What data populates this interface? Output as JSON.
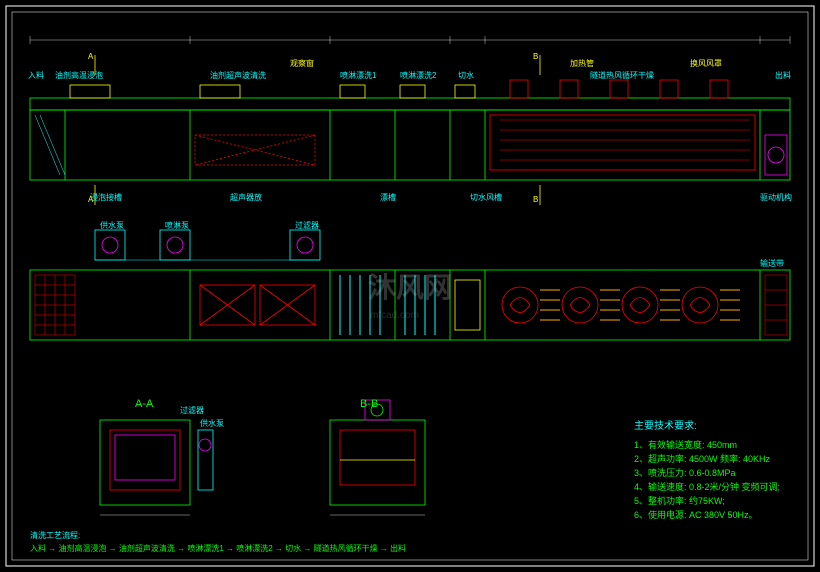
{
  "sections": {
    "A": "A",
    "AA": "A-A",
    "B": "B",
    "BB": "B-B"
  },
  "labels": {
    "inlet": "入料",
    "oil_hot_soak": "油剂高温浸泡",
    "oil_ultrasonic": "油剂超声波清洗",
    "spray_rinse1": "喷淋漂洗1",
    "spray_rinse2": "喷淋漂洗2",
    "air_cut": "切水",
    "tunnel_dry": "隧道热风循环干燥",
    "outlet": "出料",
    "view_window": "观察窗",
    "heating_tube": "加热管",
    "fan_hood": "换风风罩",
    "soak_slot": "浸泡接槽",
    "ultrasonic_box": "超声器放",
    "rinse_tank": "漂槽",
    "air_knife": "切水风槽",
    "drive": "驱动机构",
    "water_pump": "供水泵",
    "shower_pump": "喷淋泵",
    "filter": "过滤器",
    "conveyor": "输送带"
  },
  "specs": {
    "title": "主要技术要求:",
    "items": [
      "1、有效输送宽度: 450mm",
      "2、超声功率: 4500W 频率: 40KHz",
      "3、喷洗压力: 0.6-0.8MPa",
      "4、输送速度: 0.8-2米/分钟 变频可调;",
      "5、整机功率: 约75KW;",
      "6、使用电源: AC 380V  50Hz。"
    ]
  },
  "process": {
    "title": "清洗工艺流程:",
    "flow": "入料 → 油剂高温浸泡 → 油剂超声波清洗 → 喷淋漂洗1 → 喷淋漂洗2 → 切水 → 隧道热风循环干燥 → 出料"
  },
  "watermark": {
    "main": "沐风网",
    "sub": "mfcad.com"
  }
}
